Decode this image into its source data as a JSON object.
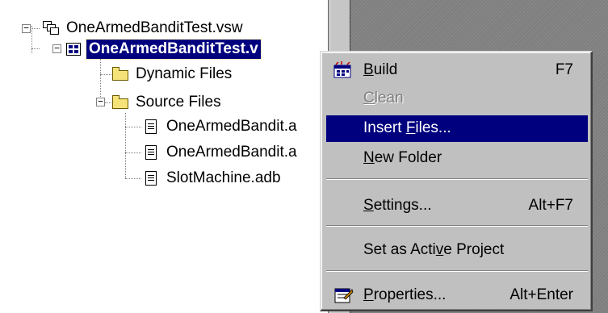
{
  "tree": {
    "workspace": "OneArmedBanditTest.vsw",
    "project": "OneArmedBanditTest.v",
    "dynamic_files": "Dynamic Files",
    "source_files": "Source Files",
    "files": [
      "OneArmedBandit.a",
      "OneArmedBandit.a",
      "SlotMachine.adb"
    ]
  },
  "menu": {
    "build": {
      "pre": "",
      "key": "B",
      "post": "uild",
      "accel": "F7"
    },
    "clean": {
      "pre": "",
      "key": "C",
      "post": "lean"
    },
    "insert_files": {
      "pre": "Insert ",
      "key": "F",
      "post": "iles..."
    },
    "new_folder": {
      "pre": "",
      "key": "N",
      "post": "ew Folder"
    },
    "settings": {
      "pre": "",
      "key": "S",
      "post": "ettings...",
      "accel": "Alt+F7"
    },
    "set_active": {
      "pre": "Set as Acti",
      "key": "v",
      "post": "e Project"
    },
    "properties": {
      "pre": "",
      "key": "P",
      "post": "roperties...",
      "accel": "Alt+Enter"
    }
  },
  "colors": {
    "highlight": "#00007f",
    "menu_face": "#c0c0c0"
  },
  "icons": [
    "workspace-icon",
    "project-icon",
    "folder-icon",
    "document-icon",
    "build-icon",
    "properties-icon"
  ]
}
